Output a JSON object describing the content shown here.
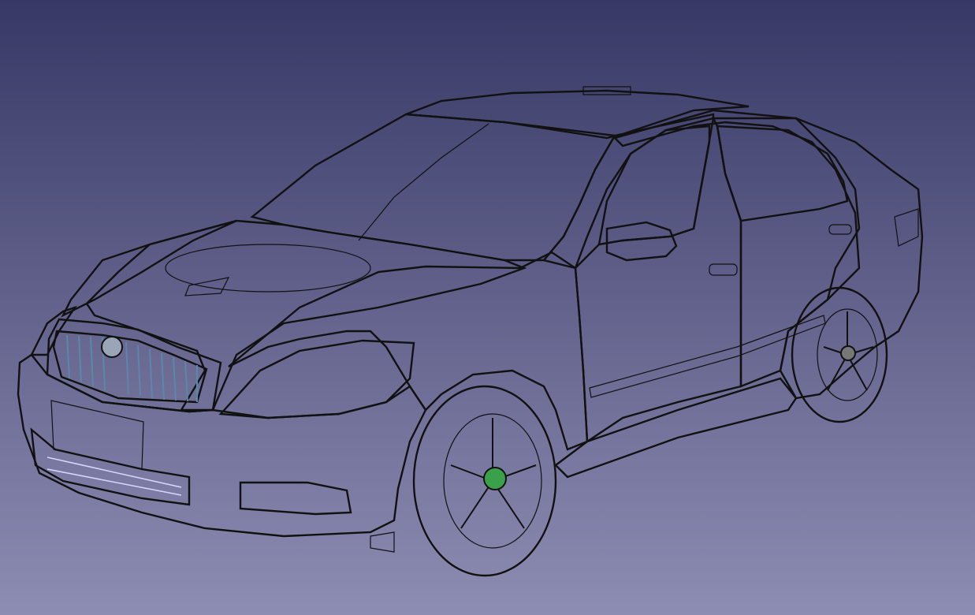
{
  "viewport": {
    "background_top": "#383866",
    "background_bottom": "#8d8db3",
    "model": "sedan-cad-model"
  },
  "part_colors": {
    "hood": "#22dd00",
    "windshield": "#0a7de8",
    "roof": "#f2f2ee",
    "front_fender": "#c21ac4",
    "front_bumper": "#7a3b36",
    "front_door": "#a9a9b1",
    "rear_door": "#c41010",
    "rear_quarter": "#6b0fc4",
    "headlamp": "#33e8e8",
    "grille": "#1d3a5c",
    "grille_surround": "#f5f01a",
    "tire": "#1c78d0",
    "wheel": "#8d8d95",
    "fog_lamp": "#7a18c8",
    "door_trim": "#1c78d0",
    "mirror": "#1c78d0"
  }
}
